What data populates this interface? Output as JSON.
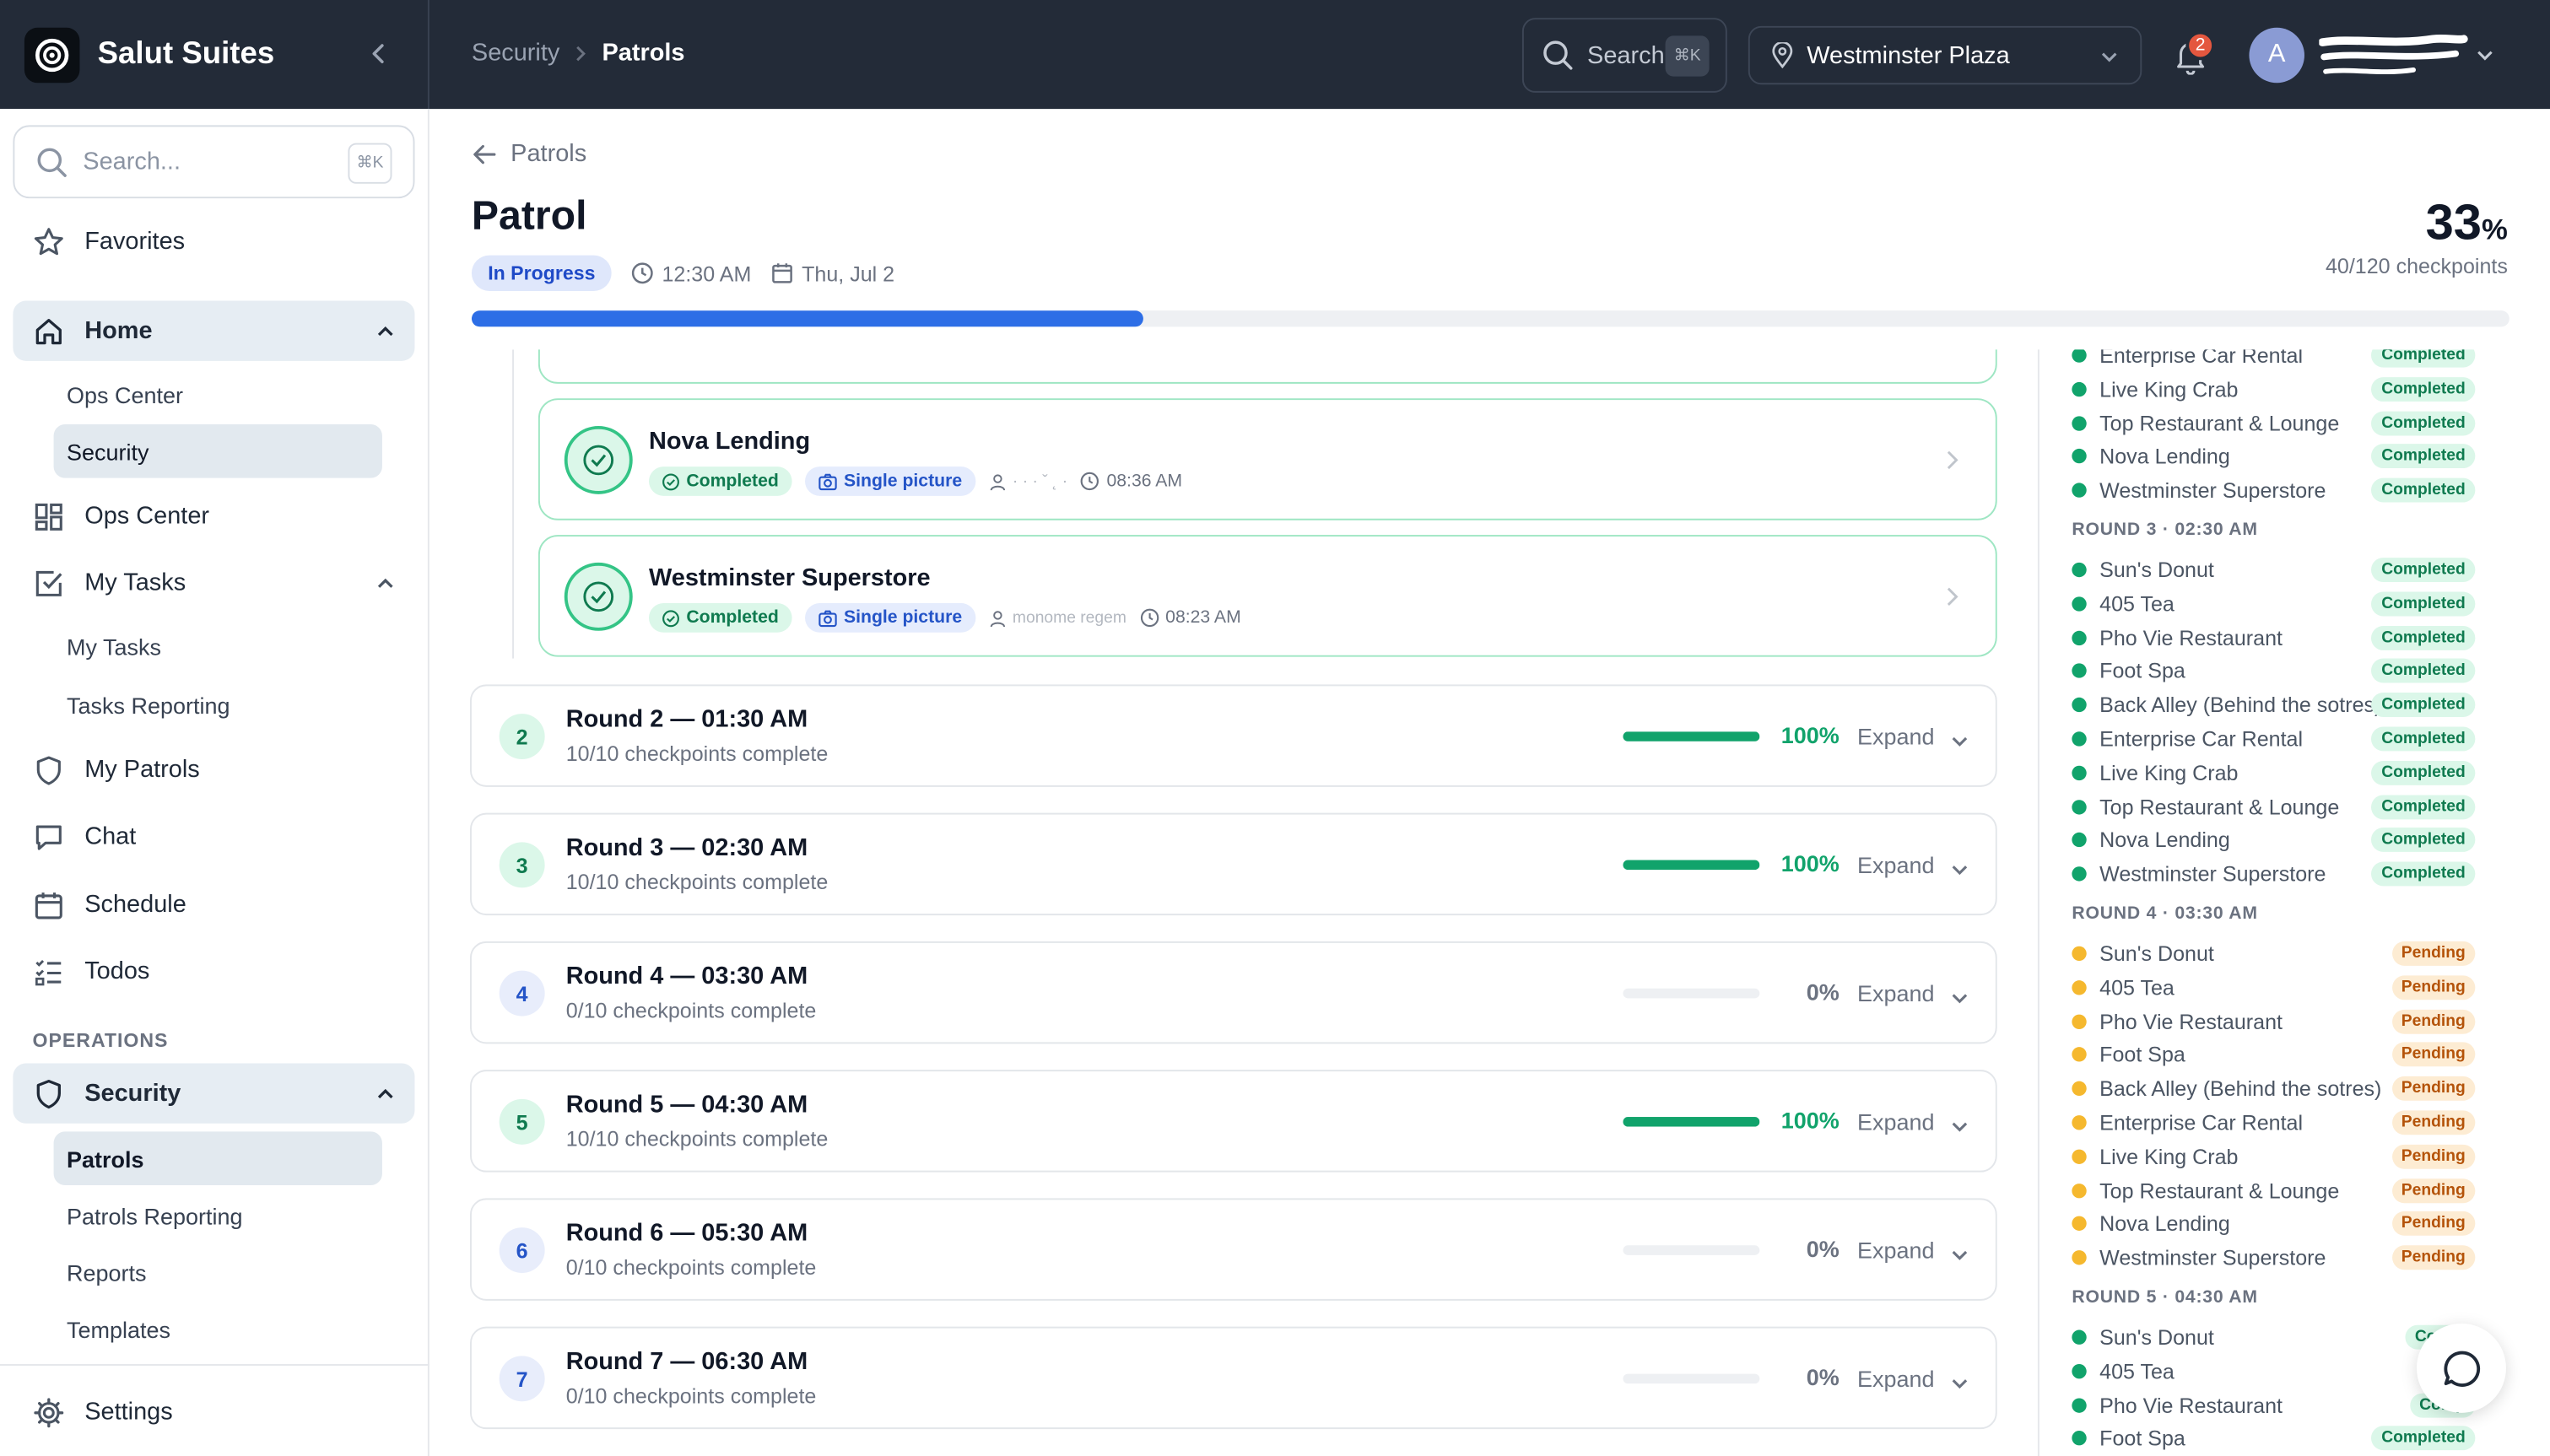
{
  "app": {
    "name": "Salut Suites"
  },
  "breadcrumb": {
    "parent": "Security",
    "current": "Patrols"
  },
  "topbar": {
    "search_label": "Search",
    "search_shortcut": "⌘K",
    "location": "Westminster Plaza",
    "notifications": "2",
    "avatar_initial": "A"
  },
  "sidebar": {
    "search_placeholder": "Search...",
    "search_shortcut": "⌘K",
    "favorites": "Favorites",
    "home": "Home",
    "home_items": [
      "Ops Center",
      "Security"
    ],
    "ops_center": "Ops Center",
    "my_tasks": "My Tasks",
    "my_tasks_items": [
      "My Tasks",
      "Tasks Reporting"
    ],
    "my_patrols": "My Patrols",
    "chat": "Chat",
    "schedule": "Schedule",
    "todos": "Todos",
    "operations_label": "OPERATIONS",
    "security": "Security",
    "security_items": [
      "Patrols",
      "Patrols Reporting",
      "Reports",
      "Templates"
    ],
    "settings": "Settings"
  },
  "patrol": {
    "back_label": "Patrols",
    "title": "Patrol",
    "status": "In Progress",
    "time": "12:30 AM",
    "date": "Thu, Jul 2",
    "percent": "33",
    "percent_symbol": "%",
    "progress_fraction": 0.33,
    "checkpoints_summary": "40/120 checkpoints"
  },
  "checkpoints": [
    {
      "name": "Nova Lending",
      "status": "Completed",
      "method": "Single picture",
      "user": "· · · ˇ ˛ ·",
      "time": "08:36 AM"
    },
    {
      "name": "Westminster Superstore",
      "status": "Completed",
      "method": "Single picture",
      "user": "monome regem",
      "time": "08:23 AM"
    }
  ],
  "rounds": [
    {
      "num": "2",
      "title": "Round 2 — 01:30 AM",
      "summary": "10/10 checkpoints complete",
      "percent": "100%",
      "fraction": 1.0,
      "expand": "Expand"
    },
    {
      "num": "3",
      "title": "Round 3 — 02:30 AM",
      "summary": "10/10 checkpoints complete",
      "percent": "100%",
      "fraction": 1.0,
      "expand": "Expand"
    },
    {
      "num": "4",
      "title": "Round 4 — 03:30 AM",
      "summary": "0/10 checkpoints complete",
      "percent": "0%",
      "fraction": 0.0,
      "expand": "Expand"
    },
    {
      "num": "5",
      "title": "Round 5 — 04:30 AM",
      "summary": "10/10 checkpoints complete",
      "percent": "100%",
      "fraction": 1.0,
      "expand": "Expand"
    },
    {
      "num": "6",
      "title": "Round 6 — 05:30 AM",
      "summary": "0/10 checkpoints complete",
      "percent": "0%",
      "fraction": 0.0,
      "expand": "Expand"
    },
    {
      "num": "7",
      "title": "Round 7 — 06:30 AM",
      "summary": "0/10 checkpoints complete",
      "percent": "0%",
      "fraction": 0.0,
      "expand": "Expand"
    }
  ],
  "overview": {
    "round2_tail": [
      {
        "name": "Enterprise Car Rental",
        "status": "Completed"
      },
      {
        "name": "Live King Crab",
        "status": "Completed"
      },
      {
        "name": "Top Restaurant & Lounge",
        "status": "Completed"
      },
      {
        "name": "Nova Lending",
        "status": "Completed"
      },
      {
        "name": "Westminster Superstore",
        "status": "Completed"
      }
    ],
    "round3_label": "ROUND 3 · 02:30 AM",
    "round3": [
      {
        "name": "Sun's Donut",
        "status": "Completed"
      },
      {
        "name": "405 Tea",
        "status": "Completed"
      },
      {
        "name": "Pho Vie Restaurant",
        "status": "Completed"
      },
      {
        "name": "Foot Spa",
        "status": "Completed"
      },
      {
        "name": "Back Alley (Behind the sotres)",
        "status": "Completed"
      },
      {
        "name": "Enterprise Car Rental",
        "status": "Completed"
      },
      {
        "name": "Live King Crab",
        "status": "Completed"
      },
      {
        "name": "Top Restaurant & Lounge",
        "status": "Completed"
      },
      {
        "name": "Nova Lending",
        "status": "Completed"
      },
      {
        "name": "Westminster Superstore",
        "status": "Completed"
      }
    ],
    "round4_label": "ROUND 4 · 03:30 AM",
    "round4": [
      {
        "name": "Sun's Donut",
        "status": "Pending"
      },
      {
        "name": "405 Tea",
        "status": "Pending"
      },
      {
        "name": "Pho Vie Restaurant",
        "status": "Pending"
      },
      {
        "name": "Foot Spa",
        "status": "Pending"
      },
      {
        "name": "Back Alley (Behind the sotres)",
        "status": "Pending"
      },
      {
        "name": "Enterprise Car Rental",
        "status": "Pending"
      },
      {
        "name": "Live King Crab",
        "status": "Pending"
      },
      {
        "name": "Top Restaurant & Lounge",
        "status": "Pending"
      },
      {
        "name": "Nova Lending",
        "status": "Pending"
      },
      {
        "name": "Westminster Superstore",
        "status": "Pending"
      }
    ],
    "round5_label": "ROUND 5 · 04:30 AM",
    "round5": [
      {
        "name": "Sun's Donut",
        "status": "Compl"
      },
      {
        "name": "405 Tea",
        "status": "Com"
      },
      {
        "name": "Pho Vie Restaurant",
        "status": "Comp"
      },
      {
        "name": "Foot Spa",
        "status": "Completed"
      }
    ]
  },
  "colors": {
    "accent": "#2d6ee6",
    "success": "#11a36b",
    "pending": "#f5b82e",
    "topbar": "#232b38"
  }
}
